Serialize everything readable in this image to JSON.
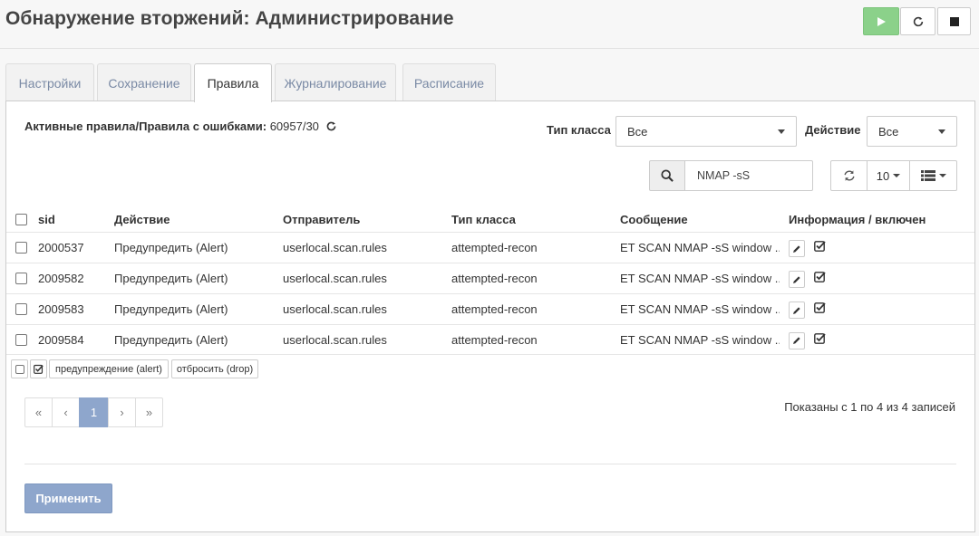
{
  "title": "Обнаружение вторжений: Администрирование",
  "header_buttons": [
    {
      "name": "start",
      "icon": "play-icon",
      "color": "#8bd18a"
    },
    {
      "name": "restart",
      "icon": "refresh-icon"
    },
    {
      "name": "stop",
      "icon": "stop-icon"
    }
  ],
  "tabs": [
    {
      "label": "Настройки",
      "active": false
    },
    {
      "label": "Сохранение",
      "active": false
    },
    {
      "label": "Правила",
      "active": true
    },
    {
      "label": "Журналирование",
      "active": false
    },
    {
      "label": "Расписание",
      "active": false
    }
  ],
  "stats": {
    "label": "Активные правила/Правила с ошибками:",
    "value": "60957/30"
  },
  "filters": {
    "class_type_label": "Тип класса",
    "class_type_value": "Все",
    "action_label": "Действие",
    "action_value": "Все"
  },
  "search": {
    "value": "NMAP -sS"
  },
  "toolbar": {
    "page_size": "10"
  },
  "columns": [
    "sid",
    "Действие",
    "Отправитель",
    "Тип класса",
    "Сообщение",
    "Информация / включен"
  ],
  "rows": [
    {
      "sid": "2000537",
      "action": "Предупредить (Alert)",
      "source": "userlocal.scan.rules",
      "classtype": "attempted-recon",
      "message": "ET SCAN NMAP -sS window ...",
      "enabled": true
    },
    {
      "sid": "2009582",
      "action": "Предупредить (Alert)",
      "source": "userlocal.scan.rules",
      "classtype": "attempted-recon",
      "message": "ET SCAN NMAP -sS window ...",
      "enabled": true
    },
    {
      "sid": "2009583",
      "action": "Предупредить (Alert)",
      "source": "userlocal.scan.rules",
      "classtype": "attempted-recon",
      "message": "ET SCAN NMAP -sS window ...",
      "enabled": true
    },
    {
      "sid": "2009584",
      "action": "Предупредить (Alert)",
      "source": "userlocal.scan.rules",
      "classtype": "attempted-recon",
      "message": "ET SCAN NMAP -sS window ...",
      "enabled": true
    }
  ],
  "legend": {
    "alert": "предупреждение (alert)",
    "drop": "отбросить (drop)"
  },
  "pagination": {
    "first": "«",
    "prev": "‹",
    "current": "1",
    "next": "›",
    "last": "»"
  },
  "showing": "Показаны с 1 по 4 из 4 записей",
  "apply_label": "Применить"
}
